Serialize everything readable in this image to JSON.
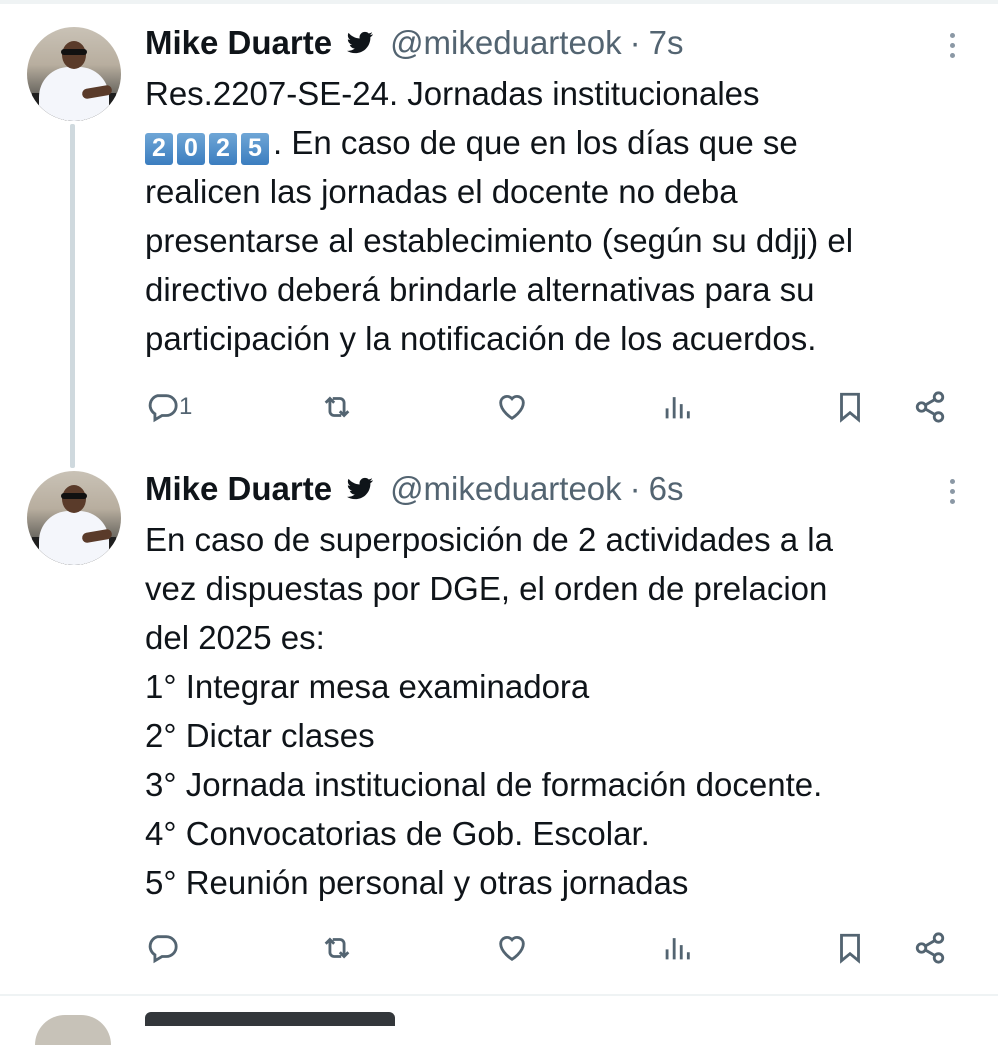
{
  "tweets": [
    {
      "author": "Mike Duarte",
      "handle": "@mikeduarteok",
      "separator": "·",
      "time": "7s",
      "text_line1": "Res.2207-SE-24. Jornadas institucionales",
      "keycaps": [
        "2",
        "0",
        "2",
        "5"
      ],
      "text_rest": ". En caso de que en los días que se\nrealicen las jornadas el docente no deba\npresentarse al establecimiento (según su ddjj) el\ndirectivo deberá brindarle alternativas para su\nparticipación y la notificación de los acuerdos.",
      "reply_count": "1"
    },
    {
      "author": "Mike Duarte",
      "handle": "@mikeduarteok",
      "separator": "·",
      "time": "6s",
      "text": "En caso de superposición de 2 actividades a la\nvez dispuestas por DGE, el orden de prelacion\ndel 2025 es:\n1° Integrar mesa examinadora\n2° Dictar clases\n3° Jornada institucional de formación docente.\n4° Convocatorias de Gob. Escolar.\n5° Reunión personal y otras jornadas"
    }
  ],
  "icons": [
    "verified-bird-icon",
    "more-icon",
    "reply-icon",
    "retweet-icon",
    "like-icon",
    "views-icon",
    "bookmark-icon",
    "share-icon"
  ],
  "colors": {
    "text": "#0f1419",
    "secondary": "#536471",
    "thread_line": "#cfd9de"
  }
}
